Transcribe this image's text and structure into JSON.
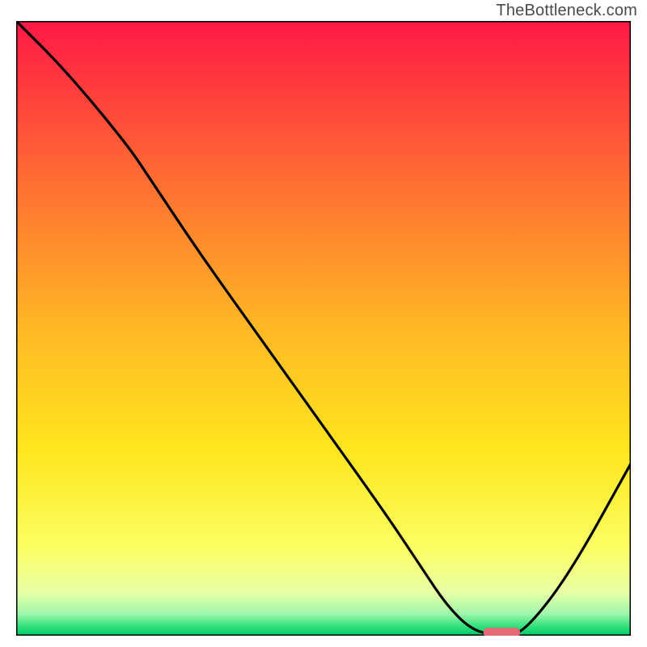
{
  "watermark": "TheBottleneck.com",
  "chart_data": {
    "type": "line",
    "title": "",
    "xlabel": "",
    "ylabel": "",
    "xlim": [
      0,
      100
    ],
    "ylim": [
      0,
      100
    ],
    "grid": false,
    "legend": false,
    "background_gradient": {
      "type": "vertical",
      "stops": [
        {
          "pos": 0.0,
          "color": "#ff1846"
        },
        {
          "pos": 0.25,
          "color": "#ff6a33"
        },
        {
          "pos": 0.5,
          "color": "#ffb824"
        },
        {
          "pos": 0.7,
          "color": "#ffe61e"
        },
        {
          "pos": 0.86,
          "color": "#fbff64"
        },
        {
          "pos": 0.93,
          "color": "#e8ffa8"
        },
        {
          "pos": 0.965,
          "color": "#9cf7aa"
        },
        {
          "pos": 0.985,
          "color": "#30e07a"
        },
        {
          "pos": 1.0,
          "color": "#00c96a"
        }
      ]
    },
    "series": [
      {
        "name": "bottleneck-curve",
        "color": "#000000",
        "x": [
          0,
          8,
          18,
          22,
          30,
          40,
          50,
          60,
          66,
          70,
          74,
          78,
          80,
          83,
          90,
          100
        ],
        "y": [
          100,
          92,
          80,
          74,
          62,
          48,
          34,
          20,
          11,
          5,
          1,
          0,
          0,
          1,
          10,
          28
        ]
      }
    ],
    "marker": {
      "name": "optimal-range-marker",
      "shape": "pill",
      "color": "#e66a75",
      "x_center": 79,
      "y": 0.5,
      "width": 6,
      "height": 1.6
    }
  }
}
